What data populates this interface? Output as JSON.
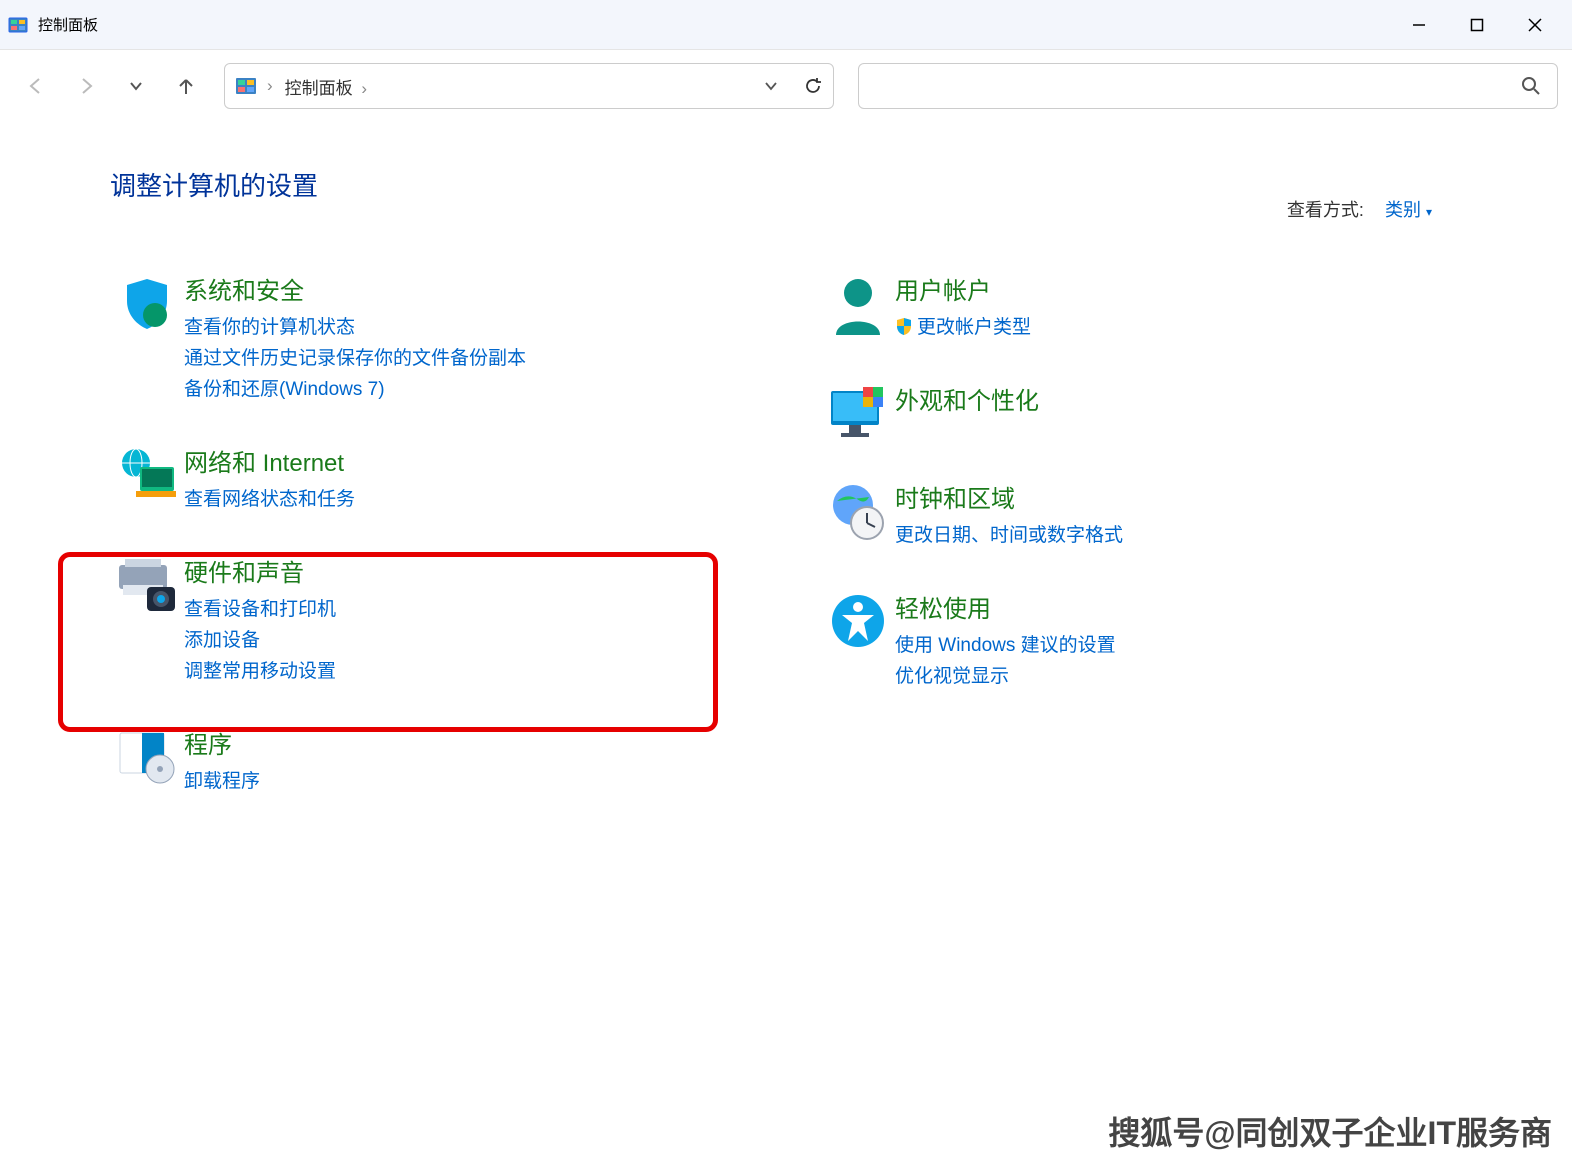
{
  "window": {
    "title": "控制面板"
  },
  "breadcrumb": {
    "root": "控制面板",
    "sep": "›"
  },
  "heading": "调整计算机的设置",
  "viewBy": {
    "label": "查看方式:",
    "value": "类别",
    "arrow": "▾"
  },
  "leftCol": [
    {
      "id": "system-security",
      "title": "系统和安全",
      "links": [
        "查看你的计算机状态",
        "通过文件历史记录保存你的文件备份副本",
        "备份和还原(Windows 7)"
      ]
    },
    {
      "id": "network-internet",
      "title": "网络和 Internet",
      "links": [
        "查看网络状态和任务"
      ]
    },
    {
      "id": "hardware-sound",
      "title": "硬件和声音",
      "links": [
        "查看设备和打印机",
        "添加设备",
        "调整常用移动设置"
      ]
    },
    {
      "id": "programs",
      "title": "程序",
      "links": [
        "卸载程序"
      ]
    }
  ],
  "rightCol": [
    {
      "id": "user-accounts",
      "title": "用户帐户",
      "links": [
        "更改帐户类型"
      ],
      "shield": [
        true
      ]
    },
    {
      "id": "appearance",
      "title": "外观和个性化",
      "links": []
    },
    {
      "id": "clock-region",
      "title": "时钟和区域",
      "links": [
        "更改日期、时间或数字格式"
      ]
    },
    {
      "id": "ease-of-access",
      "title": "轻松使用",
      "links": [
        "使用 Windows 建议的设置",
        "优化视觉显示"
      ]
    }
  ],
  "watermark": "搜狐号@同创双子企业IT服务商"
}
